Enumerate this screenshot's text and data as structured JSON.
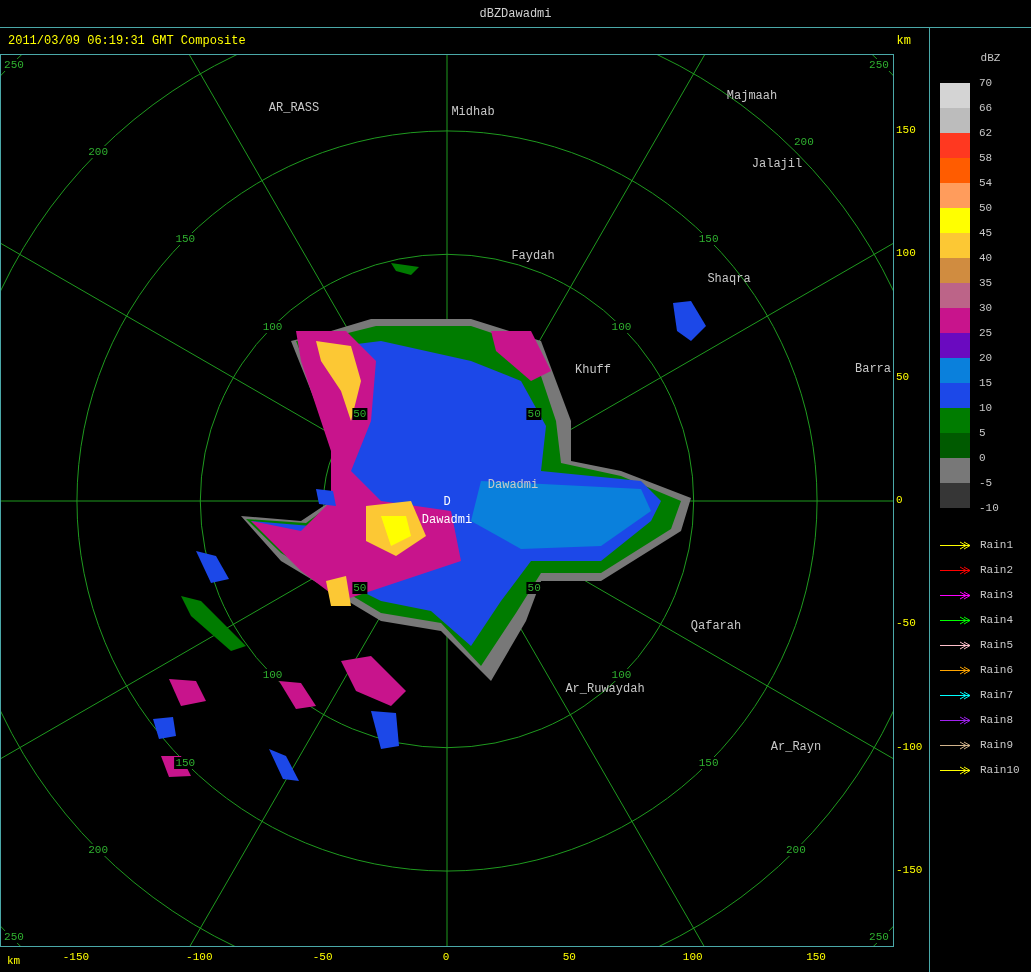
{
  "window": {
    "title": "dBZDawadmi"
  },
  "header": {
    "timestamp": "2011/03/09 06:19:31 GMT Composite",
    "unit": "km"
  },
  "range_rings": [
    {
      "labels": [
        "50",
        "50",
        "50",
        "50"
      ]
    },
    {
      "labels": [
        "100",
        "100",
        "100",
        "100"
      ]
    },
    {
      "labels": [
        "150",
        "150",
        "150",
        "150"
      ]
    },
    {
      "labels": [
        "200",
        "200",
        "200",
        "200"
      ]
    },
    {
      "labels": [
        "250",
        "250",
        "250",
        "250"
      ]
    }
  ],
  "places": [
    {
      "name": "AR_RASS",
      "kind": "town"
    },
    {
      "name": "Midhab",
      "kind": "town"
    },
    {
      "name": "Majmaah",
      "kind": "town"
    },
    {
      "name": "Jalajil",
      "kind": "town"
    },
    {
      "name": "Faydah",
      "kind": "town"
    },
    {
      "name": "Shaqra",
      "kind": "town"
    },
    {
      "name": "Khuff",
      "kind": "town"
    },
    {
      "name": "Barra",
      "kind": "town"
    },
    {
      "name": "Dawadmi",
      "kind": "town"
    },
    {
      "name": "D",
      "kind": "site"
    },
    {
      "name": "Dawadmi",
      "kind": "site"
    },
    {
      "name": "Qafarah",
      "kind": "town"
    },
    {
      "name": "Ar_Ruwaydah",
      "kind": "town"
    },
    {
      "name": "Ar_Rayn",
      "kind": "town"
    }
  ],
  "x_axis": {
    "unit": "km",
    "ticks": [
      "-150",
      "-100",
      "-50",
      "0",
      "50",
      "100",
      "150"
    ]
  },
  "y_axis": {
    "ticks": [
      "150",
      "100",
      "50",
      "0",
      "-50",
      "-100",
      "-150"
    ]
  },
  "legend": {
    "title": "dBZ",
    "labels": [
      "70",
      "66",
      "62",
      "58",
      "54",
      "50",
      "45",
      "40",
      "35",
      "30",
      "25",
      "20",
      "15",
      "10",
      "5",
      "0",
      "-5",
      "-10"
    ],
    "bands": [
      {
        "color": "#d4d4d4"
      },
      {
        "color": "#bcbcbc"
      },
      {
        "color": "#ff3820"
      },
      {
        "color": "#ff5c00"
      },
      {
        "color": "#ff9c5c"
      },
      {
        "color": "#ffff00"
      },
      {
        "color": "#fcc834"
      },
      {
        "color": "#d08c40"
      },
      {
        "color": "#bc6488"
      },
      {
        "color": "#c8148c"
      },
      {
        "color": "#6a0ac0"
      },
      {
        "color": "#0a80dc"
      },
      {
        "color": "#1c48e8"
      },
      {
        "color": "#007c00"
      },
      {
        "color": "#005a00"
      },
      {
        "color": "#787878"
      },
      {
        "color": "#363636"
      }
    ]
  },
  "tracks": [
    {
      "label": "Rain1",
      "color": "#ffff00"
    },
    {
      "label": "Rain2",
      "color": "#ff0000"
    },
    {
      "label": "Rain3",
      "color": "#ff00ff"
    },
    {
      "label": "Rain4",
      "color": "#00ff00"
    },
    {
      "label": "Rain5",
      "color": "#ffc0cb"
    },
    {
      "label": "Rain6",
      "color": "#ffa500"
    },
    {
      "label": "Rain7",
      "color": "#00ffff"
    },
    {
      "label": "Rain8",
      "color": "#a020f0"
    },
    {
      "label": "Rain9",
      "color": "#d2b48c"
    },
    {
      "label": "Rain10",
      "color": "#ffff00"
    }
  ]
}
